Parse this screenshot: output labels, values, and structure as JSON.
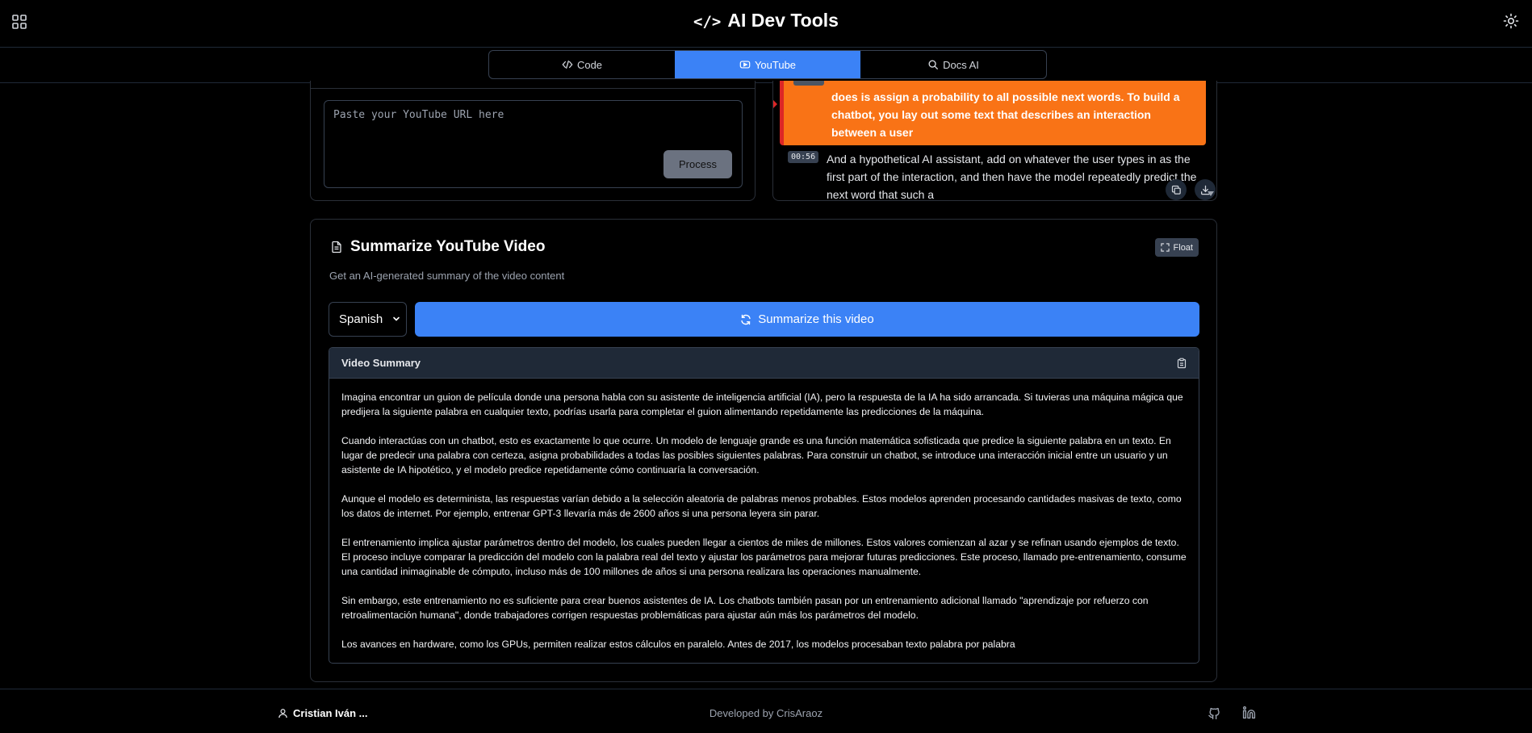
{
  "header": {
    "brand_glyph": "</>",
    "title": "AI Dev Tools"
  },
  "tabs": [
    {
      "label": "Code",
      "icon": "code-icon",
      "active": false
    },
    {
      "label": "YouTube",
      "icon": "youtube-icon",
      "active": true
    },
    {
      "label": "Docs AI",
      "icon": "search-icon",
      "active": false
    }
  ],
  "url_input": {
    "placeholder": "Paste your YouTube URL here",
    "process_label": "Process"
  },
  "transcript": {
    "highlighted_text": "does is assign a probability to all possible next words. To build a chatbot, you lay out some text that describes an interaction between a user",
    "segment_timestamp": "00:56",
    "segment_text": "And a hypothetical AI assistant, add on whatever the user types in as the first part of the interaction, and then have the model repeatedly predict the next word that such a"
  },
  "summary": {
    "title": "Summarize YouTube Video",
    "float_label": "Float",
    "subtitle": "Get an AI-generated summary of the video content",
    "language": "Spanish",
    "summarize_label": "Summarize this video",
    "panel_title": "Video Summary",
    "paragraphs": [
      "Imagina encontrar un guion de película donde una persona habla con su asistente de inteligencia artificial (IA), pero la respuesta de la IA ha sido arrancada. Si tuvieras una máquina mágica que predijera la siguiente palabra en cualquier texto, podrías usarla para completar el guion alimentando repetidamente las predicciones de la máquina.",
      "Cuando interactúas con un chatbot, esto es exactamente lo que ocurre. Un modelo de lenguaje grande es una función matemática sofisticada que predice la siguiente palabra en un texto. En lugar de predecir una palabra con certeza, asigna probabilidades a todas las posibles siguientes palabras. Para construir un chatbot, se introduce una interacción inicial entre un usuario y un asistente de IA hipotético, y el modelo predice repetidamente cómo continuaría la conversación.",
      "Aunque el modelo es determinista, las respuestas varían debido a la selección aleatoria de palabras menos probables. Estos modelos aprenden procesando cantidades masivas de texto, como los datos de internet. Por ejemplo, entrenar GPT-3 llevaría más de 2600 años si una persona leyera sin parar.",
      "El entrenamiento implica ajustar parámetros dentro del modelo, los cuales pueden llegar a cientos de miles de millones. Estos valores comienzan al azar y se refinan usando ejemplos de texto. El proceso incluye comparar la predicción del modelo con la palabra real del texto y ajustar los parámetros para mejorar futuras predicciones. Este proceso, llamado pre-entrenamiento, consume una cantidad inimaginable de cómputo, incluso más de 100 millones de años si una persona realizara las operaciones manualmente.",
      "Sin embargo, este entrenamiento no es suficiente para crear buenos asistentes de IA. Los chatbots también pasan por un entrenamiento adicional llamado \"aprendizaje por refuerzo con retroalimentación humana\", donde trabajadores corrigen respuestas problemáticas para ajustar aún más los parámetros del modelo.",
      "Los avances en hardware, como los GPUs, permiten realizar estos cálculos en paralelo. Antes de 2017, los modelos procesaban texto palabra por palabra"
    ]
  },
  "footer": {
    "author": "Cristian Iván ...",
    "developed_by": "Developed by CrisAraoz"
  }
}
